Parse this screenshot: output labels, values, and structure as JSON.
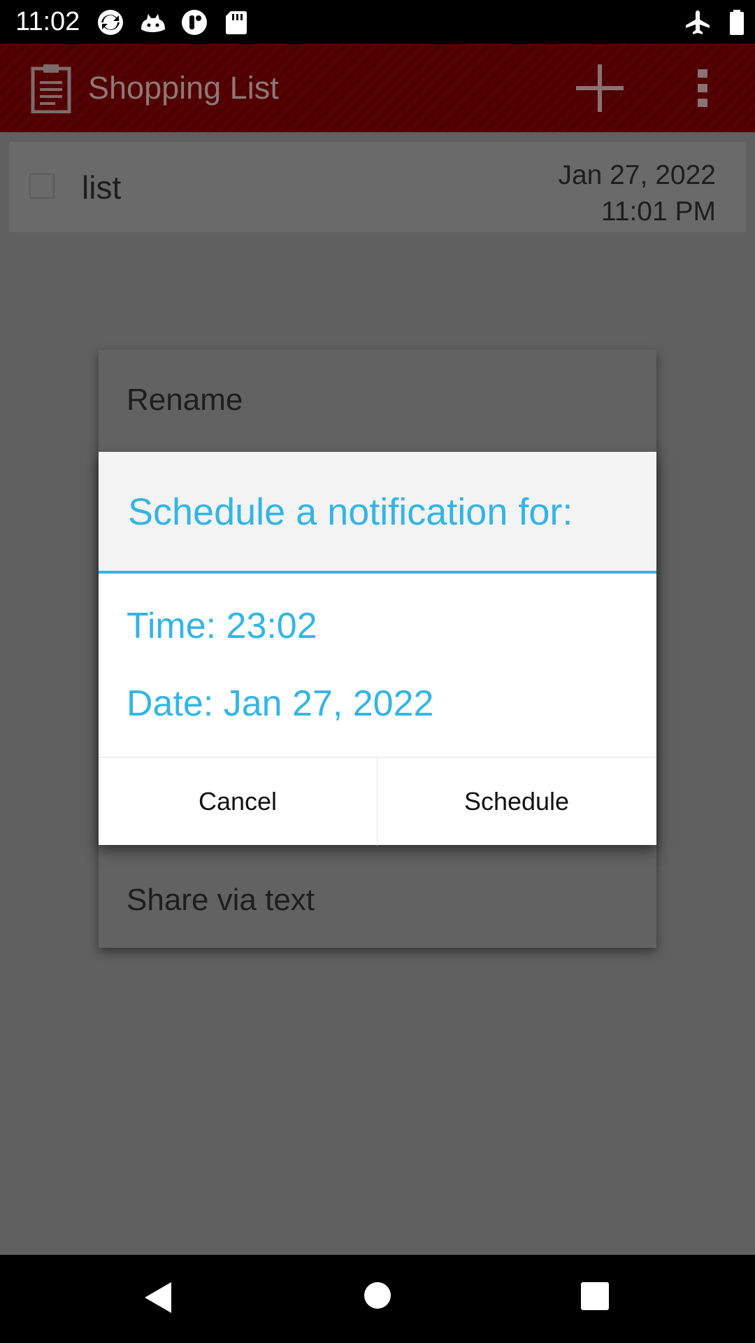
{
  "status_bar": {
    "time": "11:02",
    "left_icons": [
      "sync-icon",
      "cat-icon",
      "podcast-icon",
      "sd-card-icon"
    ],
    "right_icons": [
      "airplane-mode-icon",
      "battery-icon"
    ]
  },
  "app_bar": {
    "title": "Shopping List",
    "icons": [
      "clipboard-list-icon",
      "plus-icon",
      "more-vert-icon"
    ],
    "color": "#560203"
  },
  "list_items": [
    {
      "name": "list",
      "date": "Jan 27, 2022",
      "time": "11:01 PM",
      "checked": false
    }
  ],
  "context_menu": {
    "items": [
      "Rename",
      "Share via text"
    ]
  },
  "dialog": {
    "title": "Schedule a notification for:",
    "time_line": "Time: 23:02",
    "date_line": "Date: Jan 27, 2022",
    "cancel_label": "Cancel",
    "schedule_label": "Schedule",
    "accent_color": "#33b5e5"
  },
  "nav_bar": {
    "icons": [
      "back-icon",
      "home-icon",
      "recents-icon"
    ]
  }
}
